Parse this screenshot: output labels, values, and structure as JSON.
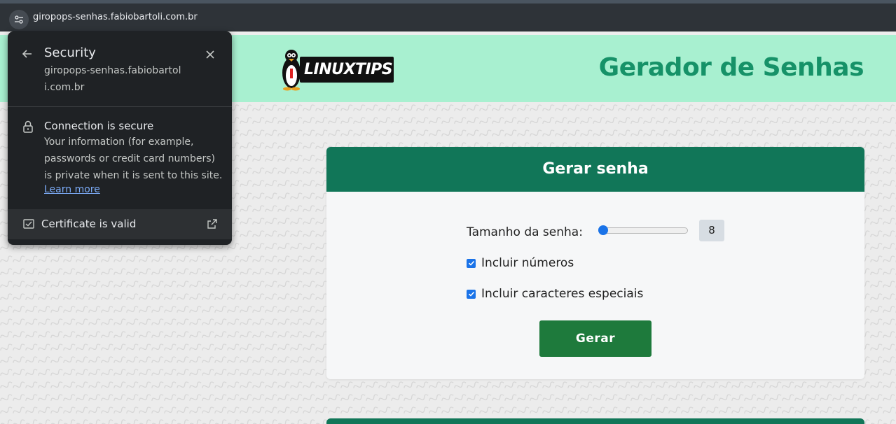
{
  "browser": {
    "url": "giropops-senhas.fabiobartoli.com.br"
  },
  "security_popup": {
    "title": "Security",
    "domain": "giropops-senhas.fabiobartoli.com.br",
    "connection_title": "Connection is secure",
    "connection_description": "Your information (for example, passwords or credit card numbers) is private when it is sent to this site.",
    "learn_more": "Learn more",
    "certificate_label": "Certificate is valid"
  },
  "header": {
    "logo_text": "LINUXTIPS",
    "title": "Gerador de Senhas"
  },
  "card": {
    "title": "Gerar senha",
    "size_label": "Tamanho da senha:",
    "size_value": "8",
    "slider_fraction": 0.0,
    "include_numbers_label": "Incluir números",
    "include_numbers_checked": true,
    "include_special_label": "Incluir caracteres especiais",
    "include_special_checked": true,
    "generate_button": "Gerar"
  },
  "colors": {
    "header_bg": "#a8f0d0",
    "title_green": "#169268",
    "card_header": "#117658",
    "button_green": "#1e7a3c",
    "accent_blue": "#1a73e8"
  }
}
